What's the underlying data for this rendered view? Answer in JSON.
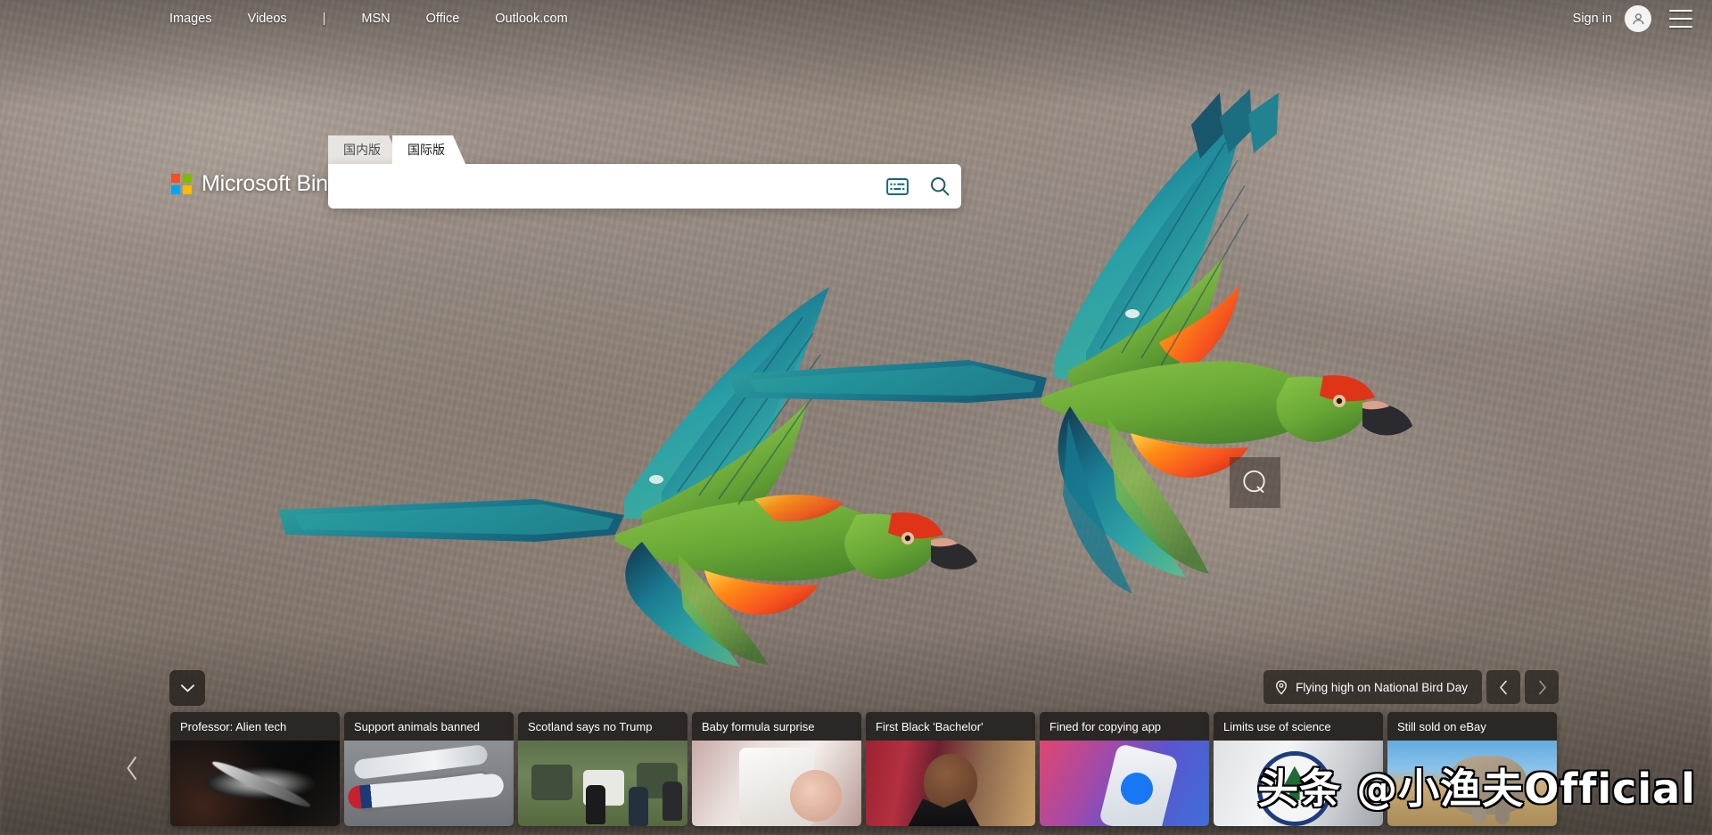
{
  "header": {
    "nav_items": [
      {
        "label": "Images",
        "name": "nav-images"
      },
      {
        "label": "Videos",
        "name": "nav-videos"
      },
      {
        "label": "|",
        "name": "nav-separator"
      },
      {
        "label": "MSN",
        "name": "nav-msn"
      },
      {
        "label": "Office",
        "name": "nav-office"
      },
      {
        "label": "Outlook.com",
        "name": "nav-outlook"
      }
    ],
    "sign_in_label": "Sign in",
    "avatar_icon": "person-icon",
    "menu_icon": "hamburger-menu-icon"
  },
  "brand": {
    "name": "Microsoft Bing",
    "logo_colors": [
      "#f25022",
      "#7fba00",
      "#00a4ef",
      "#ffb900"
    ]
  },
  "search": {
    "tabs": [
      {
        "label": "国内版",
        "active": false
      },
      {
        "label": "国际版",
        "active": true
      }
    ],
    "placeholder": "",
    "value": "",
    "keyboard_icon": "keyboard-icon",
    "search_icon": "search-icon",
    "icon_color": "#17697c"
  },
  "visual_search": {
    "icon": "visual-search-q-icon",
    "label": "Q"
  },
  "bottom": {
    "expand_icon": "chevron-down-icon",
    "info": {
      "location_icon": "location-pin-icon",
      "caption": "Flying high on National Bird Day",
      "prev_icon": "chevron-left-icon",
      "next_icon": "chevron-right-icon"
    },
    "carousel_prev_icon": "chevron-left-icon"
  },
  "news_cards": [
    {
      "title": "Professor: Alien tech",
      "thumb": "th-asteroid"
    },
    {
      "title": "Support animals banned",
      "thumb": "th-planes"
    },
    {
      "title": "Scotland says no Trump",
      "thumb": "th-golf"
    },
    {
      "title": "Baby formula surprise",
      "thumb": "th-baby"
    },
    {
      "title": "First Black 'Bachelor'",
      "thumb": "th-bachelor"
    },
    {
      "title": "Fined for copying app",
      "thumb": "th-facebook"
    },
    {
      "title": "Limits use of science",
      "thumb": "th-epa"
    },
    {
      "title": "Still sold on eBay",
      "thumb": "th-elephant"
    }
  ],
  "watermark": {
    "text": "头条 @小渔夫Official"
  },
  "background": {
    "description": "Two red-fronted macaws in flight over a blurred rocky backdrop",
    "base_color": "#9c9088"
  }
}
